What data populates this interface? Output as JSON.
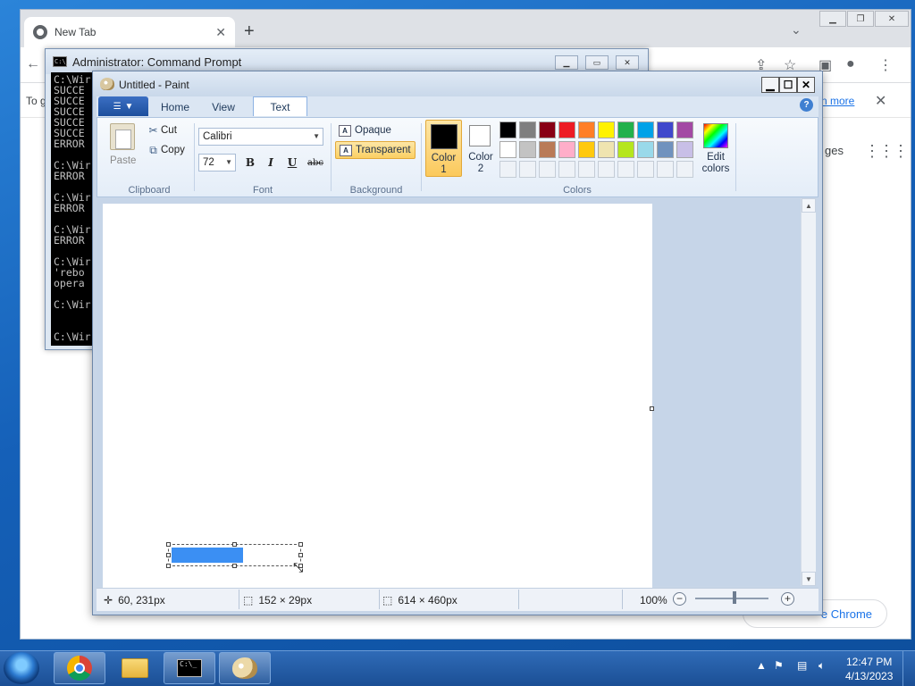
{
  "chrome": {
    "tab_title": "New Tab",
    "new_tab": "+",
    "info_text": "To g",
    "learn_more": "n more",
    "images_link": "ges",
    "customize_button": "e Chrome"
  },
  "cmd": {
    "title": "Administrator:  Command Prompt",
    "lines": "C:\\Wir\nSUCCE\nSUCCE\nSUCCE\nSUCCE\nSUCCE\nERROR\n\nC:\\Wir\nERROR\n\nC:\\Wir\nERROR\n\nC:\\Wir\nERROR\n\nC:\\Wir\n'rebo\nopera\n\nC:\\Wir\n\n\nC:\\Wir"
  },
  "paint": {
    "title": "Untitled - Paint",
    "tabs": [
      "Home",
      "View",
      "Text"
    ],
    "active_tab": "Text",
    "clipboard": {
      "paste": "Paste",
      "cut": "Cut",
      "copy": "Copy",
      "label": "Clipboard"
    },
    "font": {
      "family": "Calibri",
      "size": "72",
      "bold": "B",
      "italic": "I",
      "underline": "U",
      "strike": "abc",
      "label": "Font"
    },
    "background": {
      "opaque": "Opaque",
      "transparent": "Transparent",
      "label": "Background",
      "selected": "Transparent"
    },
    "colors": {
      "color1_label": "Color\n1",
      "color2_label": "Color\n2",
      "color1": "#000000",
      "color2": "#ffffff",
      "edit_colors": "Edit\ncolors",
      "label": "Colors",
      "palette_row1": [
        "#000000",
        "#7f7f7f",
        "#880015",
        "#ed1c24",
        "#ff7f27",
        "#fff200",
        "#22b14c",
        "#00a2e8",
        "#3f48cc",
        "#a349a4"
      ],
      "palette_row2": [
        "#ffffff",
        "#c3c3c3",
        "#b97a57",
        "#ffaec9",
        "#ffc90e",
        "#efe4b0",
        "#b5e61d",
        "#99d9ea",
        "#7092be",
        "#c8bfe7"
      ]
    },
    "status": {
      "cursor_pos": "60, 231px",
      "selection_size": "152 × 29px",
      "image_size": "614 × 460px",
      "zoom": "100%"
    }
  },
  "taskbar": {
    "time": "12:47 PM",
    "date": "4/13/2023"
  }
}
